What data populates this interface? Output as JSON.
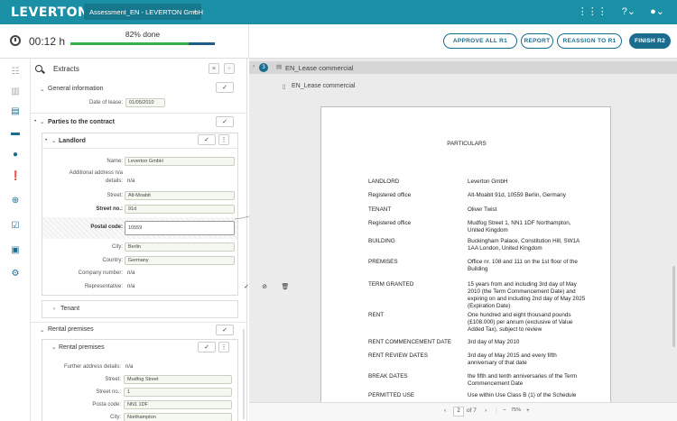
{
  "header": {
    "logo": "LEVERTON",
    "document_selector": "Assessment_EN - LEVERTON GmbH",
    "chevron": "⌄",
    "icons": [
      "apps-grid-icon",
      "help-icon",
      "user-icon"
    ],
    "grid_glyph": "⋮⋮⋮",
    "help_glyph": "?⌄",
    "user_glyph": "●⌄"
  },
  "toolbar": {
    "timer": "00:12 h",
    "progress_label": "82% done",
    "progress_percent": 82,
    "approve_label": "APPROVE ALL R1",
    "report_label": "REPORT",
    "reassign_label": "REASSIGN TO R1",
    "finish_label": "FINISH R2"
  },
  "extracts": {
    "title": "Extracts",
    "collapse_glyph": "×",
    "add_glyph": "+",
    "check_glyph": "✓",
    "dots_glyph": "⋮",
    "general": {
      "title": "General information",
      "date_label": "Date of lease:",
      "date_value": "01/05/2010"
    },
    "parties": {
      "title": "Parties to the contract",
      "landlord": {
        "title": "Landlord",
        "name_label": "Name:",
        "name_value": "Leverton GmbH",
        "addr_label_1": "Additional address n/a",
        "addr_label_2": "details:",
        "addr_value": "n/a",
        "street_label": "Street:",
        "street_value": "Alt-Moabit",
        "streetno_label": "Street no.:",
        "streetno_value": "91d",
        "postal_label": "Postal code:",
        "postal_value": "10559",
        "city_label": "City:",
        "city_value": "Berlin",
        "country_label": "Country:",
        "country_value": "Germany",
        "company_label": "Company number:",
        "company_value": "n/a",
        "rep_label": "Representative:",
        "rep_value": "n/a"
      },
      "tenant_title": "Tenant"
    },
    "rental": {
      "title": "Rental premises",
      "sub_title": "Rental premises",
      "further_label": "Further address details:",
      "further_value": "n/a",
      "street_label": "Street:",
      "street_value": "Mudfog Street",
      "streetno_label": "Street no.:",
      "streetno_value": "1",
      "postal_label": "Posta code:",
      "postal_value": "NN1 1DF",
      "city_label": "City:",
      "city_value": "Northampton"
    }
  },
  "viewer": {
    "badge": "3",
    "title": "EN_Lease commercial",
    "doc_line": "EN_Lease commercial",
    "mini_tools": [
      "✓",
      "⊘",
      "🗑"
    ],
    "page": {
      "heading": "PARTICULARS",
      "rows": [
        {
          "label": "LANDLORD",
          "value": "Leverton GmbH"
        },
        {
          "label": "Registered office",
          "value": "Alt-Moabit 91d, 10559 Berlin, Germany"
        },
        {
          "label": "TENANT",
          "value": "Oliver Twist"
        },
        {
          "label": "Registered office",
          "value": "Mudfog Street 1, NN1 1DF Northampton, United Kingdom"
        },
        {
          "label": "BUILDING",
          "value": "Buckingham Palace, Constitution Hill, SW1A 1AA London, United Kingdom"
        },
        {
          "label": "PREMISES",
          "value": "Office nr. 108 and 111 on the 1st floor of the Building"
        },
        {
          "label": "TERM GRANTED",
          "value": "15 years from and including 3rd day of May 2010 (the Term Commencement Date) and expiring on and including 2nd day of May 2025 (Expiration Date)"
        },
        {
          "label": "RENT",
          "value": "One hundred and eight thousand pounds (£108.000) per annum (exclusive of Value Added Tax), subject to review"
        },
        {
          "label": "RENT COMMENCEMENT DATE",
          "value": "3rd day of May 2010"
        },
        {
          "label": "RENT REVIEW DATES",
          "value": "3rd day of May 2015 and every fifth anniversary of that date"
        },
        {
          "label": "BREAK DATES",
          "value": "the fifth and tenth anniversaries of the Term Commencement Date"
        },
        {
          "label": "PERMITTED USE",
          "value": "Use within Use Class B (1) of the Schedule"
        }
      ]
    },
    "pager": {
      "prev": "‹",
      "page": "2",
      "of": "of 7",
      "next": "›",
      "zoom_out": "−",
      "zoom": "75%",
      "zoom_in": "+"
    }
  },
  "colors": {
    "brand": "#1a8fa6",
    "accent": "#1a6d8f",
    "progress": "#38b04a"
  }
}
